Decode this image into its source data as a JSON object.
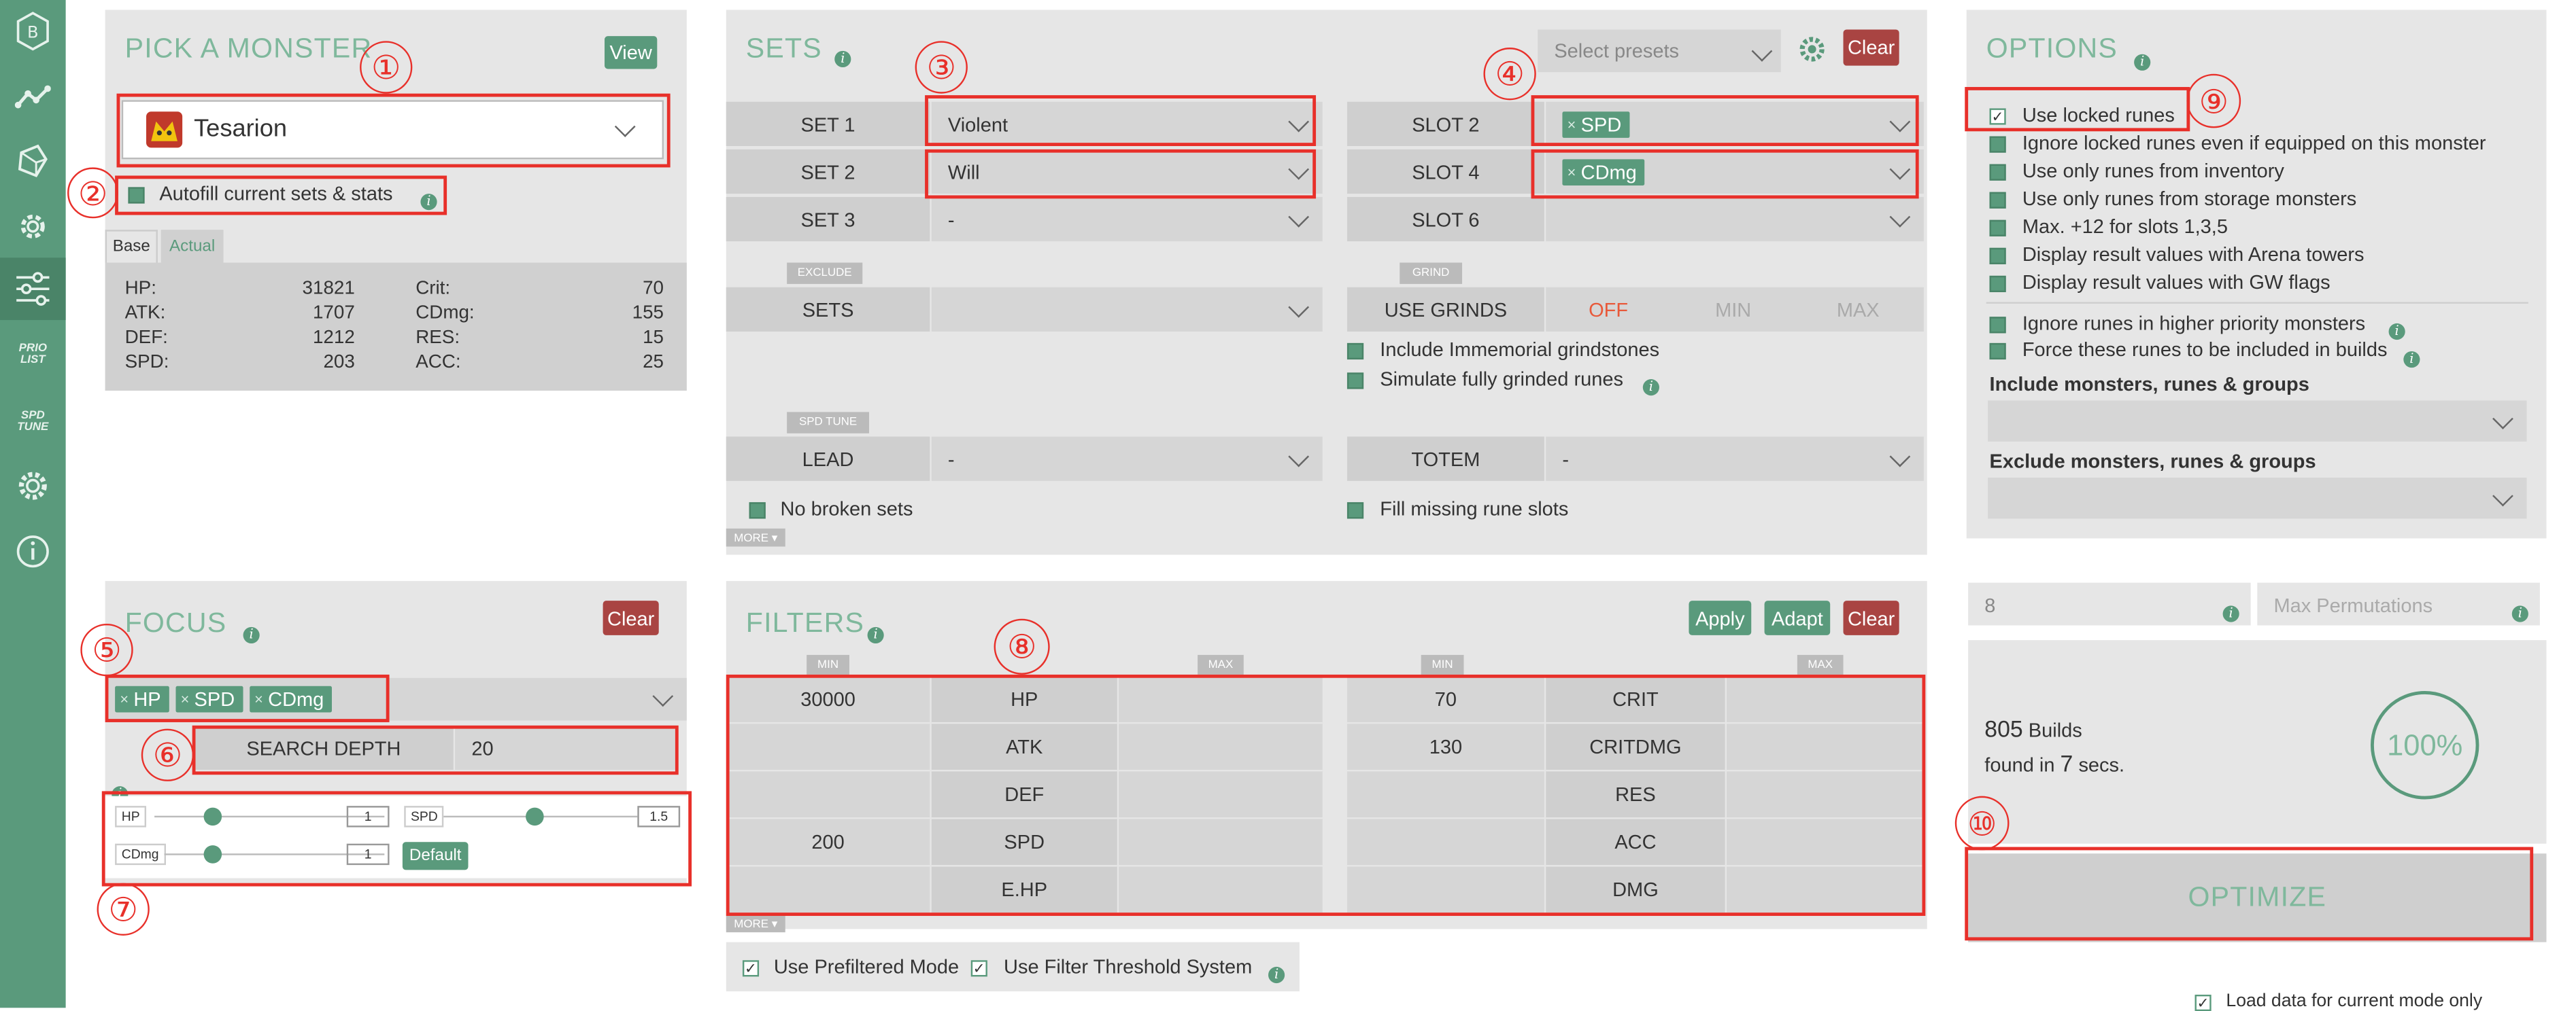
{
  "sidebar": {
    "items": [
      {
        "icon": "logo-icon"
      },
      {
        "icon": "chart-line-icon"
      },
      {
        "icon": "rune-icon"
      },
      {
        "icon": "monster-gear-icon"
      },
      {
        "icon": "sliders-icon"
      },
      {
        "icon": "prio-list-icon",
        "label": "PRIO LIST"
      },
      {
        "icon": "spd-tune-icon",
        "label": "SPD TUNE"
      },
      {
        "icon": "settings-gear-icon"
      },
      {
        "icon": "info-icon"
      }
    ]
  },
  "monster": {
    "title": "PICK A MONSTER",
    "view_label": "View",
    "selected": "Tesarion",
    "autofill_label": "Autofill current sets & stats",
    "tabs": [
      "Base",
      "Actual"
    ],
    "stats_left": [
      {
        "label": "HP:",
        "value": "31821"
      },
      {
        "label": "ATK:",
        "value": "1707"
      },
      {
        "label": "DEF:",
        "value": "1212"
      },
      {
        "label": "SPD:",
        "value": "203"
      }
    ],
    "stats_right": [
      {
        "label": "Crit:",
        "value": "70"
      },
      {
        "label": "CDmg:",
        "value": "155"
      },
      {
        "label": "RES:",
        "value": "15"
      },
      {
        "label": "ACC:",
        "value": "25"
      }
    ]
  },
  "sets": {
    "title": "SETS",
    "presets_placeholder": "Select presets",
    "clear_label": "Clear",
    "rows": [
      {
        "label": "SET 1",
        "value": "Violent"
      },
      {
        "label": "SET 2",
        "value": "Will"
      },
      {
        "label": "SET 3",
        "value": "-"
      }
    ],
    "slots": [
      {
        "label": "SLOT 2",
        "tag": "SPD"
      },
      {
        "label": "SLOT 4",
        "tag": "CDmg"
      },
      {
        "label": "SLOT 6",
        "tag": ""
      }
    ],
    "exclude_tab": "EXCLUDE",
    "exclude_label": "SETS",
    "grind_tab": "GRIND",
    "use_grinds_label": "USE GRINDS",
    "grind_options": [
      "OFF",
      "MIN",
      "MAX"
    ],
    "immemorial_label": "Include Immemorial grindstones",
    "simulate_label": "Simulate fully grinded runes",
    "spd_tune_tab": "SPD TUNE",
    "lead_label": "LEAD",
    "lead_value": "-",
    "totem_label": "TOTEM",
    "totem_value": "-",
    "no_broken_label": "No broken sets",
    "fill_missing_label": "Fill missing rune slots",
    "more_label": "MORE ▾"
  },
  "options": {
    "title": "OPTIONS",
    "items": [
      {
        "label": "Use locked runes",
        "checked": "✓"
      },
      {
        "label": "Ignore locked runes even if equipped on this monster",
        "checked": ""
      },
      {
        "label": "Use only runes from inventory",
        "checked": ""
      },
      {
        "label": "Use only runes from storage monsters",
        "checked": ""
      },
      {
        "label": "Max. +12 for slots 1,3,5",
        "checked": ""
      },
      {
        "label": "Display result values with Arena towers",
        "checked": ""
      },
      {
        "label": "Display result values with GW flags",
        "checked": ""
      }
    ],
    "ignore_higher_label": "Ignore runes in higher priority monsters",
    "force_label": "Force these runes to be included in builds",
    "include_label": "Include monsters, runes & groups",
    "exclude_label": "Exclude monsters, runes & groups"
  },
  "focus": {
    "title": "FOCUS",
    "clear_label": "Clear",
    "tags": [
      "HP",
      "SPD",
      "CDmg"
    ],
    "search_depth_label": "SEARCH DEPTH",
    "search_depth_value": "20",
    "sliders": [
      {
        "label": "HP",
        "value": "1"
      },
      {
        "label": "SPD",
        "value": "1.5"
      },
      {
        "label": "CDmg",
        "value": "1"
      }
    ],
    "default_label": "Default"
  },
  "filters": {
    "title": "FILTERS",
    "apply_label": "Apply",
    "adapt_label": "Adapt",
    "clear_label": "Clear",
    "min_label": "MIN",
    "max_label": "MAX",
    "left": [
      {
        "stat": "HP",
        "min": "30000",
        "max": ""
      },
      {
        "stat": "ATK",
        "min": "",
        "max": ""
      },
      {
        "stat": "DEF",
        "min": "",
        "max": ""
      },
      {
        "stat": "SPD",
        "min": "200",
        "max": ""
      },
      {
        "stat": "E.HP",
        "min": "",
        "max": ""
      }
    ],
    "right": [
      {
        "stat": "CRIT",
        "min": "70",
        "max": ""
      },
      {
        "stat": "CRITDMG",
        "min": "130",
        "max": ""
      },
      {
        "stat": "RES",
        "min": "",
        "max": ""
      },
      {
        "stat": "ACC",
        "min": "",
        "max": ""
      },
      {
        "stat": "DMG",
        "min": "",
        "max": ""
      }
    ],
    "more_label": "MORE ▾",
    "prefiltered_label": "Use Prefiltered Mode",
    "threshold_label": "Use Filter Threshold System"
  },
  "optimize": {
    "threads_value": "8",
    "max_perm_placeholder": "Max Permutations",
    "builds_count": "805",
    "builds_label": "Builds",
    "found_prefix": "found in",
    "seconds": "7",
    "secs_label": "secs.",
    "progress_text": "100%",
    "progress": 1.0,
    "optimize_label": "OPTIMIZE",
    "load_data_label": "Load data for current mode only"
  },
  "annotations": [
    "①",
    "②",
    "③",
    "④",
    "⑤",
    "⑥",
    "⑦",
    "⑧",
    "⑨",
    "⑩"
  ],
  "colors": {
    "accent": "#5a9a7c",
    "title": "#7fb89c",
    "danger": "#a94442",
    "annotation": "#e8302a",
    "panel": "#e6e6e6"
  }
}
